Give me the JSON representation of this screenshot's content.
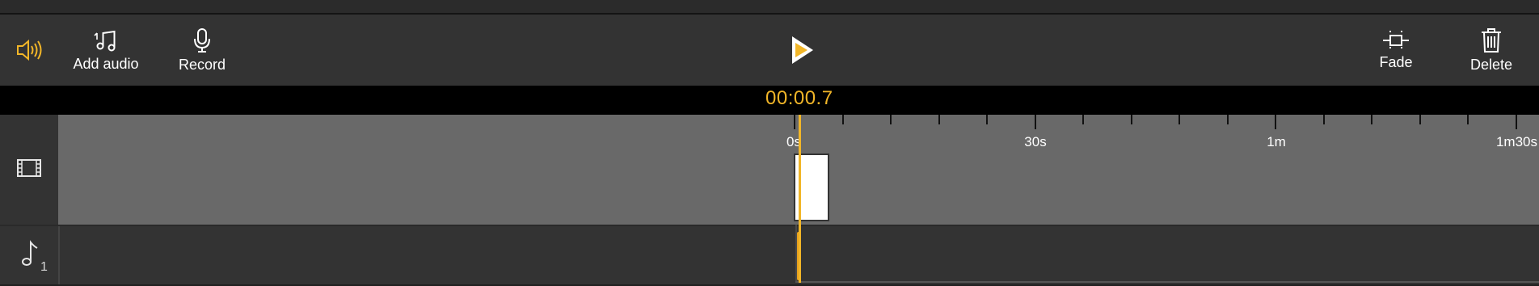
{
  "toolbar": {
    "volume_icon": "volume-icon",
    "add_audio_label": "Add audio",
    "record_label": "Record",
    "play_icon": "play-icon",
    "fade_label": "Fade",
    "delete_label": "Delete",
    "accent_color": "#f2b628"
  },
  "timeline": {
    "timecode": "00:00.7",
    "tick_labels": [
      "0s",
      "30s",
      "1m",
      "1m30s"
    ]
  },
  "tracks": {
    "video_icon": "film-strip-icon",
    "audio_icon": "music-note-icon",
    "audio_track_number": "1"
  }
}
